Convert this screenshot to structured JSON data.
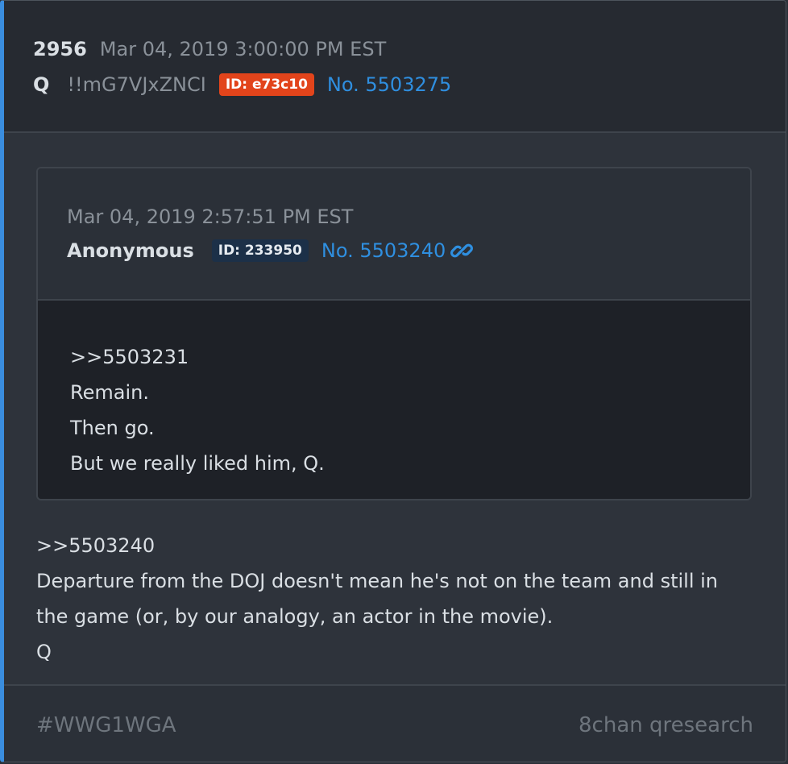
{
  "post": {
    "number": "2956",
    "timestamp": "Mar 04, 2019 3:00:00 PM EST",
    "author": "Q",
    "tripcode": "!!mG7VJxZNCI",
    "id_badge": "ID: e73c10",
    "post_link": "No. 5503275"
  },
  "quoted": {
    "timestamp": "Mar 04, 2019 2:57:51 PM EST",
    "author": "Anonymous",
    "id_badge": "ID: 233950",
    "post_link": "No. 5503240",
    "lines": [
      ">>5503231",
      "Remain.",
      "Then go.",
      "But we really liked him, Q."
    ]
  },
  "message": {
    "lines": [
      ">>5503240",
      "Departure from the DOJ doesn't mean he's not on the team and still in the game (or, by our analogy, an actor in the movie).",
      "Q"
    ]
  },
  "footer": {
    "hashtag": "#WWG1WGA",
    "source": "8chan qresearch"
  },
  "colors": {
    "accent": "#3a8dde",
    "id_badge_q": "#e2441b",
    "id_badge_anon": "#1c3048",
    "link": "#2f8fe0"
  },
  "icons": {
    "quoted_link": "link-chain-icon"
  }
}
